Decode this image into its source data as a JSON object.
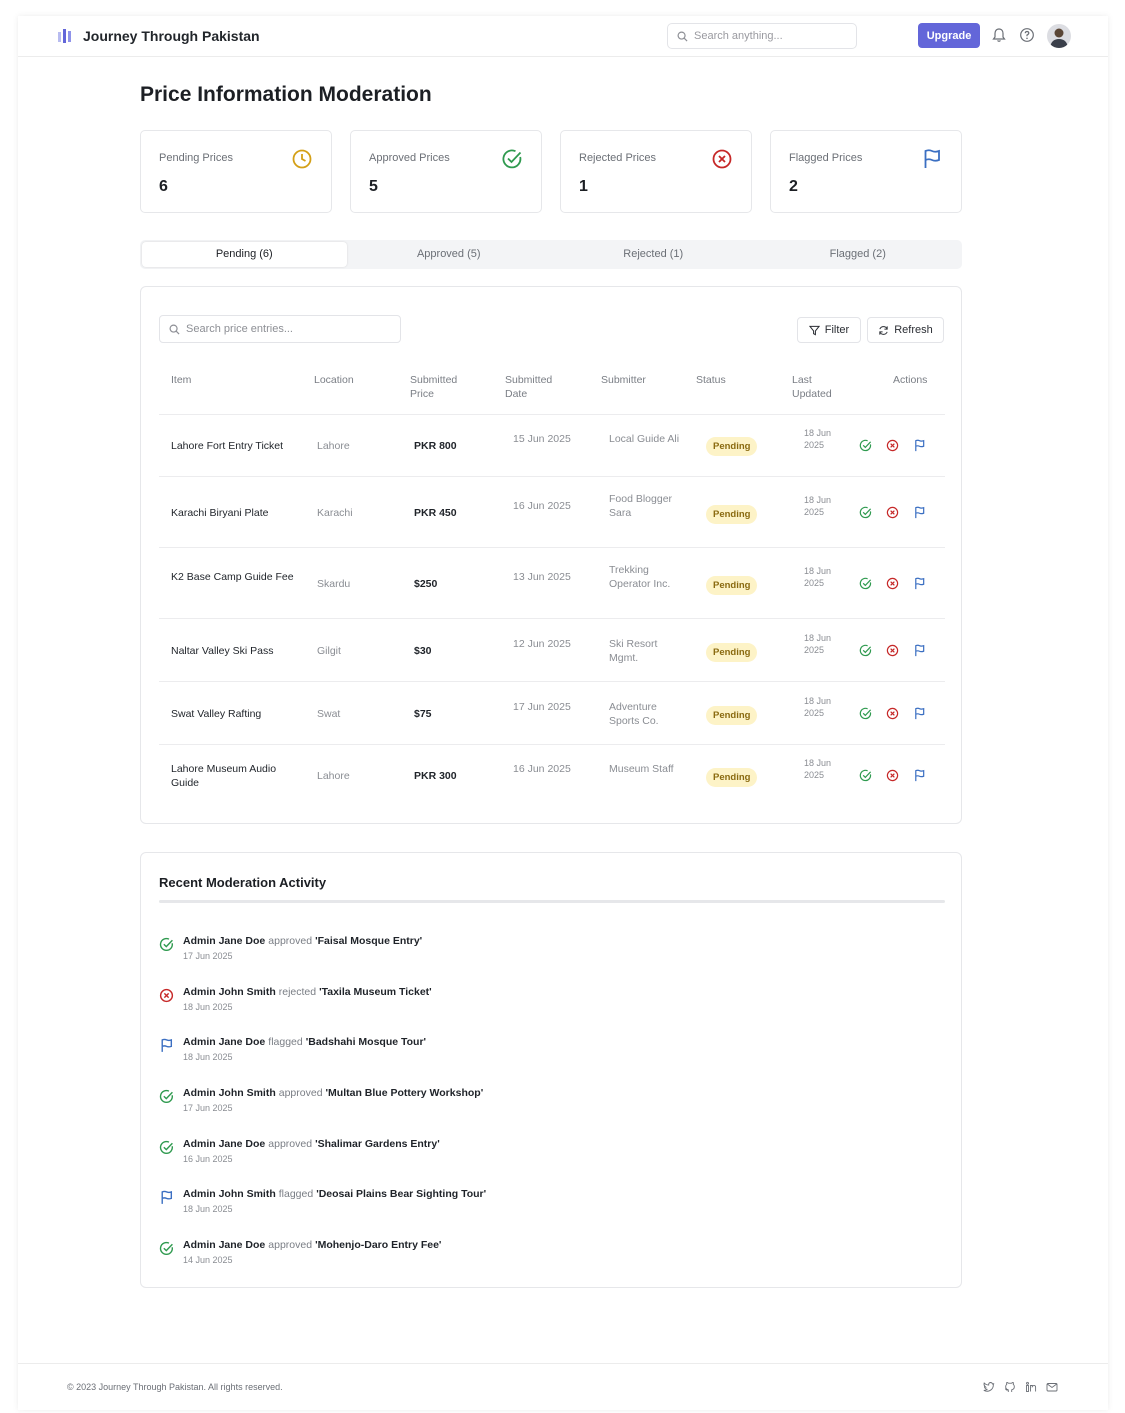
{
  "header": {
    "brand": "Journey Through Pakistan",
    "search_placeholder": "Search anything...",
    "upgrade_label": "Upgrade",
    "icons": [
      "bell-icon",
      "help-icon"
    ]
  },
  "page_title": "Price Information Moderation",
  "stats": [
    {
      "label": "Pending Prices",
      "value": "6",
      "icon": "clock-icon",
      "color": "#d4a017"
    },
    {
      "label": "Approved Prices",
      "value": "5",
      "icon": "check-circle-icon",
      "color": "#2f9a4f"
    },
    {
      "label": "Rejected Prices",
      "value": "1",
      "icon": "x-circle-icon",
      "color": "#c62828"
    },
    {
      "label": "Flagged Prices",
      "value": "2",
      "icon": "flag-icon",
      "color": "#3b6fc2"
    }
  ],
  "tabs": [
    {
      "label": "Pending (6)",
      "active": true
    },
    {
      "label": "Approved (5)",
      "active": false
    },
    {
      "label": "Rejected (1)",
      "active": false
    },
    {
      "label": "Flagged (2)",
      "active": false
    }
  ],
  "table": {
    "search_placeholder": "Search price entries...",
    "filter_label": "Filter",
    "refresh_label": "Refresh",
    "columns": [
      "Item",
      "Location",
      "Submitted Price",
      "Submitted Date",
      "Submitter",
      "Status",
      "Last Updated",
      "Actions"
    ],
    "rows": [
      {
        "item": "Lahore Fort Entry Ticket",
        "location": "Lahore",
        "price": "PKR 800",
        "date": "15 Jun 2025",
        "submitter": "Local Guide Ali",
        "status": "Pending",
        "updated": "18 Jun 2025"
      },
      {
        "item": "Karachi Biryani Plate",
        "location": "Karachi",
        "price": "PKR 450",
        "date": "16 Jun 2025",
        "submitter": "Food Blogger Sara",
        "status": "Pending",
        "updated": "18 Jun 2025"
      },
      {
        "item": "K2 Base Camp Guide Fee",
        "location": "Skardu",
        "price": "$250",
        "date": "13 Jun 2025",
        "submitter": "Trekking Operator Inc.",
        "status": "Pending",
        "updated": "18 Jun 2025"
      },
      {
        "item": "Naltar Valley Ski Pass",
        "location": "Gilgit",
        "price": "$30",
        "date": "12 Jun 2025",
        "submitter": "Ski Resort Mgmt.",
        "status": "Pending",
        "updated": "18 Jun 2025"
      },
      {
        "item": "Swat Valley Rafting",
        "location": "Swat",
        "price": "$75",
        "date": "17 Jun 2025",
        "submitter": "Adventure Sports Co.",
        "status": "Pending",
        "updated": "18 Jun 2025"
      },
      {
        "item": "Lahore Museum Audio Guide",
        "location": "Lahore",
        "price": "PKR 300",
        "date": "16 Jun 2025",
        "submitter": "Museum Staff",
        "status": "Pending",
        "updated": "18 Jun 2025"
      }
    ]
  },
  "activity": {
    "title": "Recent Moderation Activity",
    "items": [
      {
        "user": "Admin Jane Doe",
        "verb": "approved",
        "target": "'Faisal Mosque Entry'",
        "date": "17 Jun 2025",
        "type": "approved"
      },
      {
        "user": "Admin John Smith",
        "verb": "rejected",
        "target": "'Taxila Museum Ticket'",
        "date": "18 Jun 2025",
        "type": "rejected"
      },
      {
        "user": "Admin Jane Doe",
        "verb": "flagged",
        "target": "'Badshahi Mosque Tour'",
        "date": "18 Jun 2025",
        "type": "flagged"
      },
      {
        "user": "Admin John Smith",
        "verb": "approved",
        "target": "'Multan Blue Pottery Workshop'",
        "date": "17 Jun 2025",
        "type": "approved"
      },
      {
        "user": "Admin Jane Doe",
        "verb": "approved",
        "target": "'Shalimar Gardens Entry'",
        "date": "16 Jun 2025",
        "type": "approved"
      },
      {
        "user": "Admin John Smith",
        "verb": "flagged",
        "target": "'Deosai Plains Bear Sighting Tour'",
        "date": "18 Jun 2025",
        "type": "flagged"
      },
      {
        "user": "Admin Jane Doe",
        "verb": "approved",
        "target": "'Mohenjo-Daro Entry Fee'",
        "date": "14 Jun 2025",
        "type": "approved"
      }
    ]
  },
  "footer": {
    "copyright": "© 2023 Journey Through Pakistan. All rights reserved.",
    "icons": [
      "twitter-icon",
      "github-icon",
      "linkedin-icon",
      "mail-icon"
    ]
  },
  "colors": {
    "accent": "#6366d9",
    "pending_bg": "#fdf3c7",
    "approve": "#2f9a4f",
    "reject": "#c62828",
    "flag": "#3b6fc2"
  }
}
